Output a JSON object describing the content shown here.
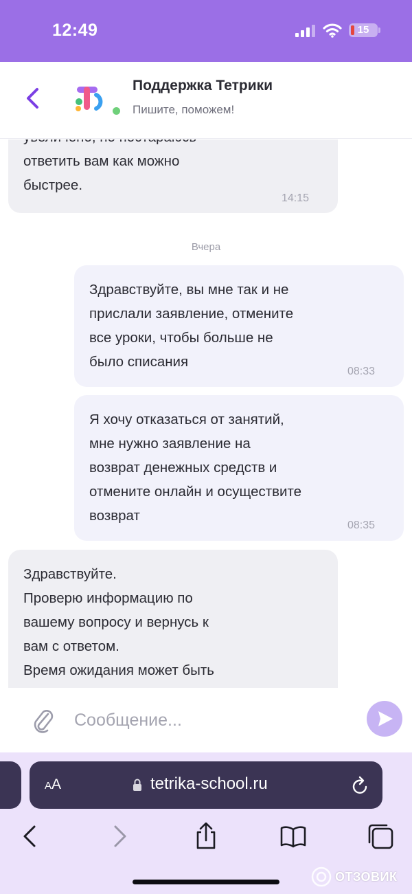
{
  "status_bar": {
    "time": "12:49",
    "battery_level": "15"
  },
  "header": {
    "title": "Поддержка Тетрики",
    "subtitle": "Пишите, поможем!"
  },
  "messages": [
    {
      "direction": "incoming",
      "text": "увеличено, но постараюсь\nответить вам как можно\nбыстрее.",
      "time": "14:15"
    },
    {
      "direction": "outgoing",
      "text": "Здравствуйте, вы мне так и не\nприслали заявление, отмените\nвсе уроки, чтобы больше не\nбыло списания",
      "time": "08:33"
    },
    {
      "direction": "outgoing",
      "text": "Я хочу отказаться от занятий,\nмне нужно заявление на\nвозврат денежных средств и\nотмените онлайн и осуществите\nвозврат",
      "time": "08:35"
    },
    {
      "direction": "incoming",
      "text": "Здравствуйте.\nПроверю информацию по\nвашему вопросу и вернусь к\nвам с ответом.\nВремя ожидания может быть",
      "time": ""
    }
  ],
  "day_separator": "Вчера",
  "composer": {
    "placeholder": "Сообщение..."
  },
  "browser": {
    "aa_label_small": "A",
    "aa_label_large": "A",
    "url": "tetrika-school.ru"
  },
  "watermark": {
    "text": "ОТЗОВИК"
  },
  "colors": {
    "status_bar": "#9b6fe6",
    "accent": "#7b3fe4",
    "online": "#6fd07a",
    "send_button": "#c7b4f4",
    "browser_bar": "#3b3454"
  },
  "icons": {
    "back": "chevron-left-icon",
    "attach": "paperclip-icon",
    "send": "send-icon",
    "lock": "lock-icon",
    "reload": "reload-icon",
    "toolbar": [
      "back-icon",
      "forward-icon",
      "share-icon",
      "bookmarks-icon",
      "tabs-icon"
    ]
  }
}
